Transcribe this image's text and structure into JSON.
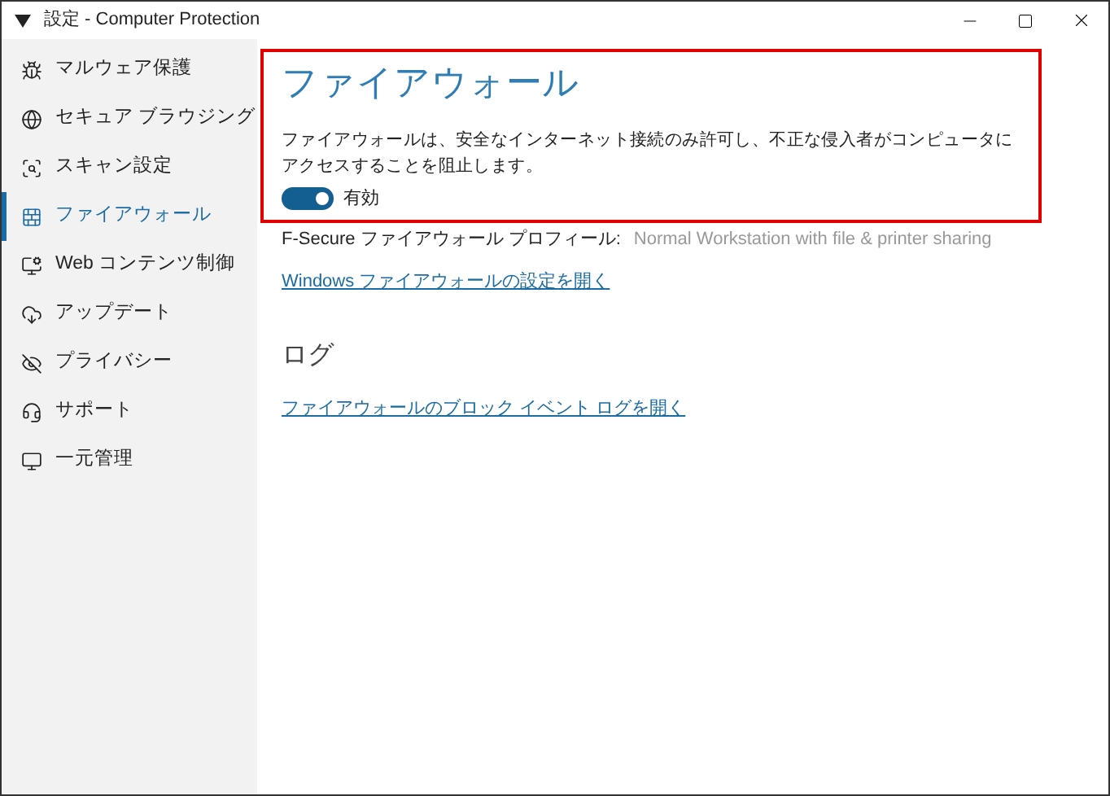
{
  "window": {
    "title": "設定 - Computer Protection"
  },
  "sidebar": {
    "items": [
      {
        "label": "マルウェア保護",
        "selected": false
      },
      {
        "label": "セキュア ブラウジング",
        "selected": false
      },
      {
        "label": "スキャン設定",
        "selected": false
      },
      {
        "label": "ファイアウォール",
        "selected": true
      },
      {
        "label": "Web コンテンツ制御",
        "selected": false
      },
      {
        "label": "アップデート",
        "selected": false
      },
      {
        "label": "プライバシー",
        "selected": false
      },
      {
        "label": "サポート",
        "selected": false
      },
      {
        "label": "一元管理",
        "selected": false
      }
    ]
  },
  "firewall": {
    "title": "ファイアウォール",
    "description": "ファイアウォールは、安全なインターネット接続のみ許可し、不正な侵入者がコンピュータにアクセスすることを阻止します。",
    "toggle": {
      "on": true,
      "label": "有効"
    },
    "profile_label": "F-Secure ファイアウォール プロフィール:",
    "profile_value": "Normal Workstation with file & printer sharing",
    "link": "Windows ファイアウォールの設定を開く"
  },
  "log": {
    "title": "ログ",
    "link": "ファイアウォールのブロック イベント ログを開く"
  }
}
